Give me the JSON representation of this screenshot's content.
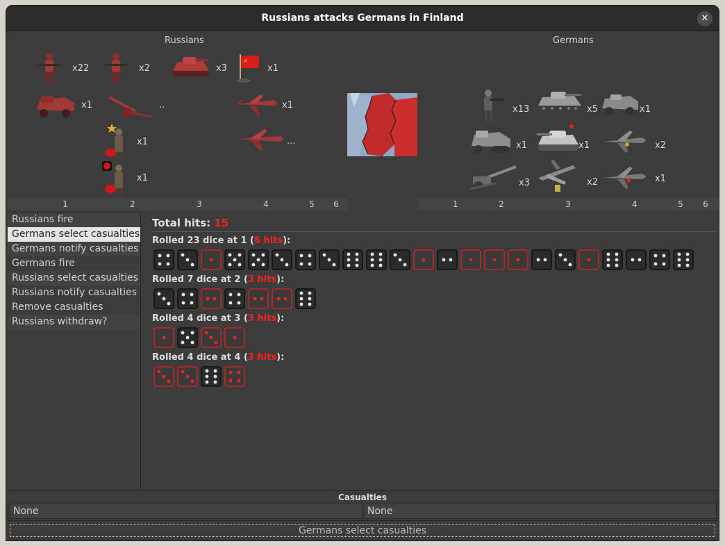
{
  "window": {
    "title": "Russians attacks Germans in Finland",
    "close_glyph": "✕"
  },
  "sides": {
    "attacker": {
      "name": "Russians",
      "color": "#b03a3a"
    },
    "defender": {
      "name": "Germans",
      "color": "#8a8a8a"
    }
  },
  "attacker_units": [
    {
      "icon": "infantry-icon",
      "count": "x22"
    },
    {
      "icon": "marine-icon",
      "count": "x2"
    },
    {
      "icon": "tank-icon",
      "count": "x3"
    },
    {
      "icon": "soviet-flag-icon",
      "count": "x1"
    },
    {
      "icon": "halftrack-icon",
      "count": "x1"
    },
    {
      "icon": "artillery-icon",
      "count": ".."
    },
    {
      "icon": "fighter-icon",
      "count": "x1"
    },
    {
      "icon": "general-icon",
      "count": "x1"
    },
    {
      "icon": "bomber-icon",
      "count": "..."
    },
    {
      "icon": "commissar-icon",
      "count": "x1"
    }
  ],
  "defender_units": [
    {
      "icon": "infantry-icon",
      "count": "x13"
    },
    {
      "icon": "tank-icon",
      "count": "x5"
    },
    {
      "icon": "armored-car-icon",
      "count": "x1"
    },
    {
      "icon": "halftrack-icon",
      "count": "x1"
    },
    {
      "icon": "heavy-tank-icon",
      "count": "x1"
    },
    {
      "icon": "fighter-icon",
      "count": "x2"
    },
    {
      "icon": "artillery-icon",
      "count": "x3"
    },
    {
      "icon": "bomber-icon",
      "count": "x2"
    },
    {
      "icon": "fighter-ace-icon",
      "count": "x1"
    }
  ],
  "column_numbers": [
    "1",
    "2",
    "3",
    "4",
    "5",
    "6"
  ],
  "steps": [
    "Russians fire",
    "Germans select casualties",
    "Germans notify casualties",
    "Germans fire",
    "Russians select casualties",
    "Russians notify casualties",
    "Remove casualties",
    "Russians withdraw?"
  ],
  "active_step": 1,
  "results": {
    "total_label": "Total hits: ",
    "total_hits": "15",
    "rolls": [
      {
        "prefix": "Rolled 23 dice at 1 (",
        "hits": "6 hits",
        "suffix": "):",
        "dice": [
          4,
          3,
          1,
          5,
          5,
          3,
          4,
          3,
          6,
          6,
          3,
          1,
          2,
          1,
          1,
          1,
          2,
          3,
          1,
          6,
          2,
          4,
          6
        ]
      },
      {
        "prefix": "Rolled 7 dice at 2 (",
        "hits": "3 hits",
        "suffix": "):",
        "dice": [
          3,
          4,
          2,
          4,
          2,
          2,
          6
        ]
      },
      {
        "prefix": "Rolled 4 dice at 3 (",
        "hits": "3 hits",
        "suffix": "):",
        "dice": [
          1,
          5,
          3,
          1
        ]
      },
      {
        "prefix": "Rolled 4 dice at 4 (",
        "hits": "3 hits",
        "suffix": "):",
        "dice": [
          3,
          3,
          6,
          4
        ]
      }
    ],
    "die_colors": {
      "hit_fill": "#3a3a3a",
      "hit_border": "#d32020",
      "hit_pip": "#ff2020",
      "miss_fill": "#2b2b2b",
      "miss_border": "#0f0f0f",
      "miss_pip": "#e8e8e8"
    }
  },
  "casualties": {
    "title": "Casualties",
    "attacker": "None",
    "defender": "None"
  },
  "action_button": "Germans select  casualties"
}
